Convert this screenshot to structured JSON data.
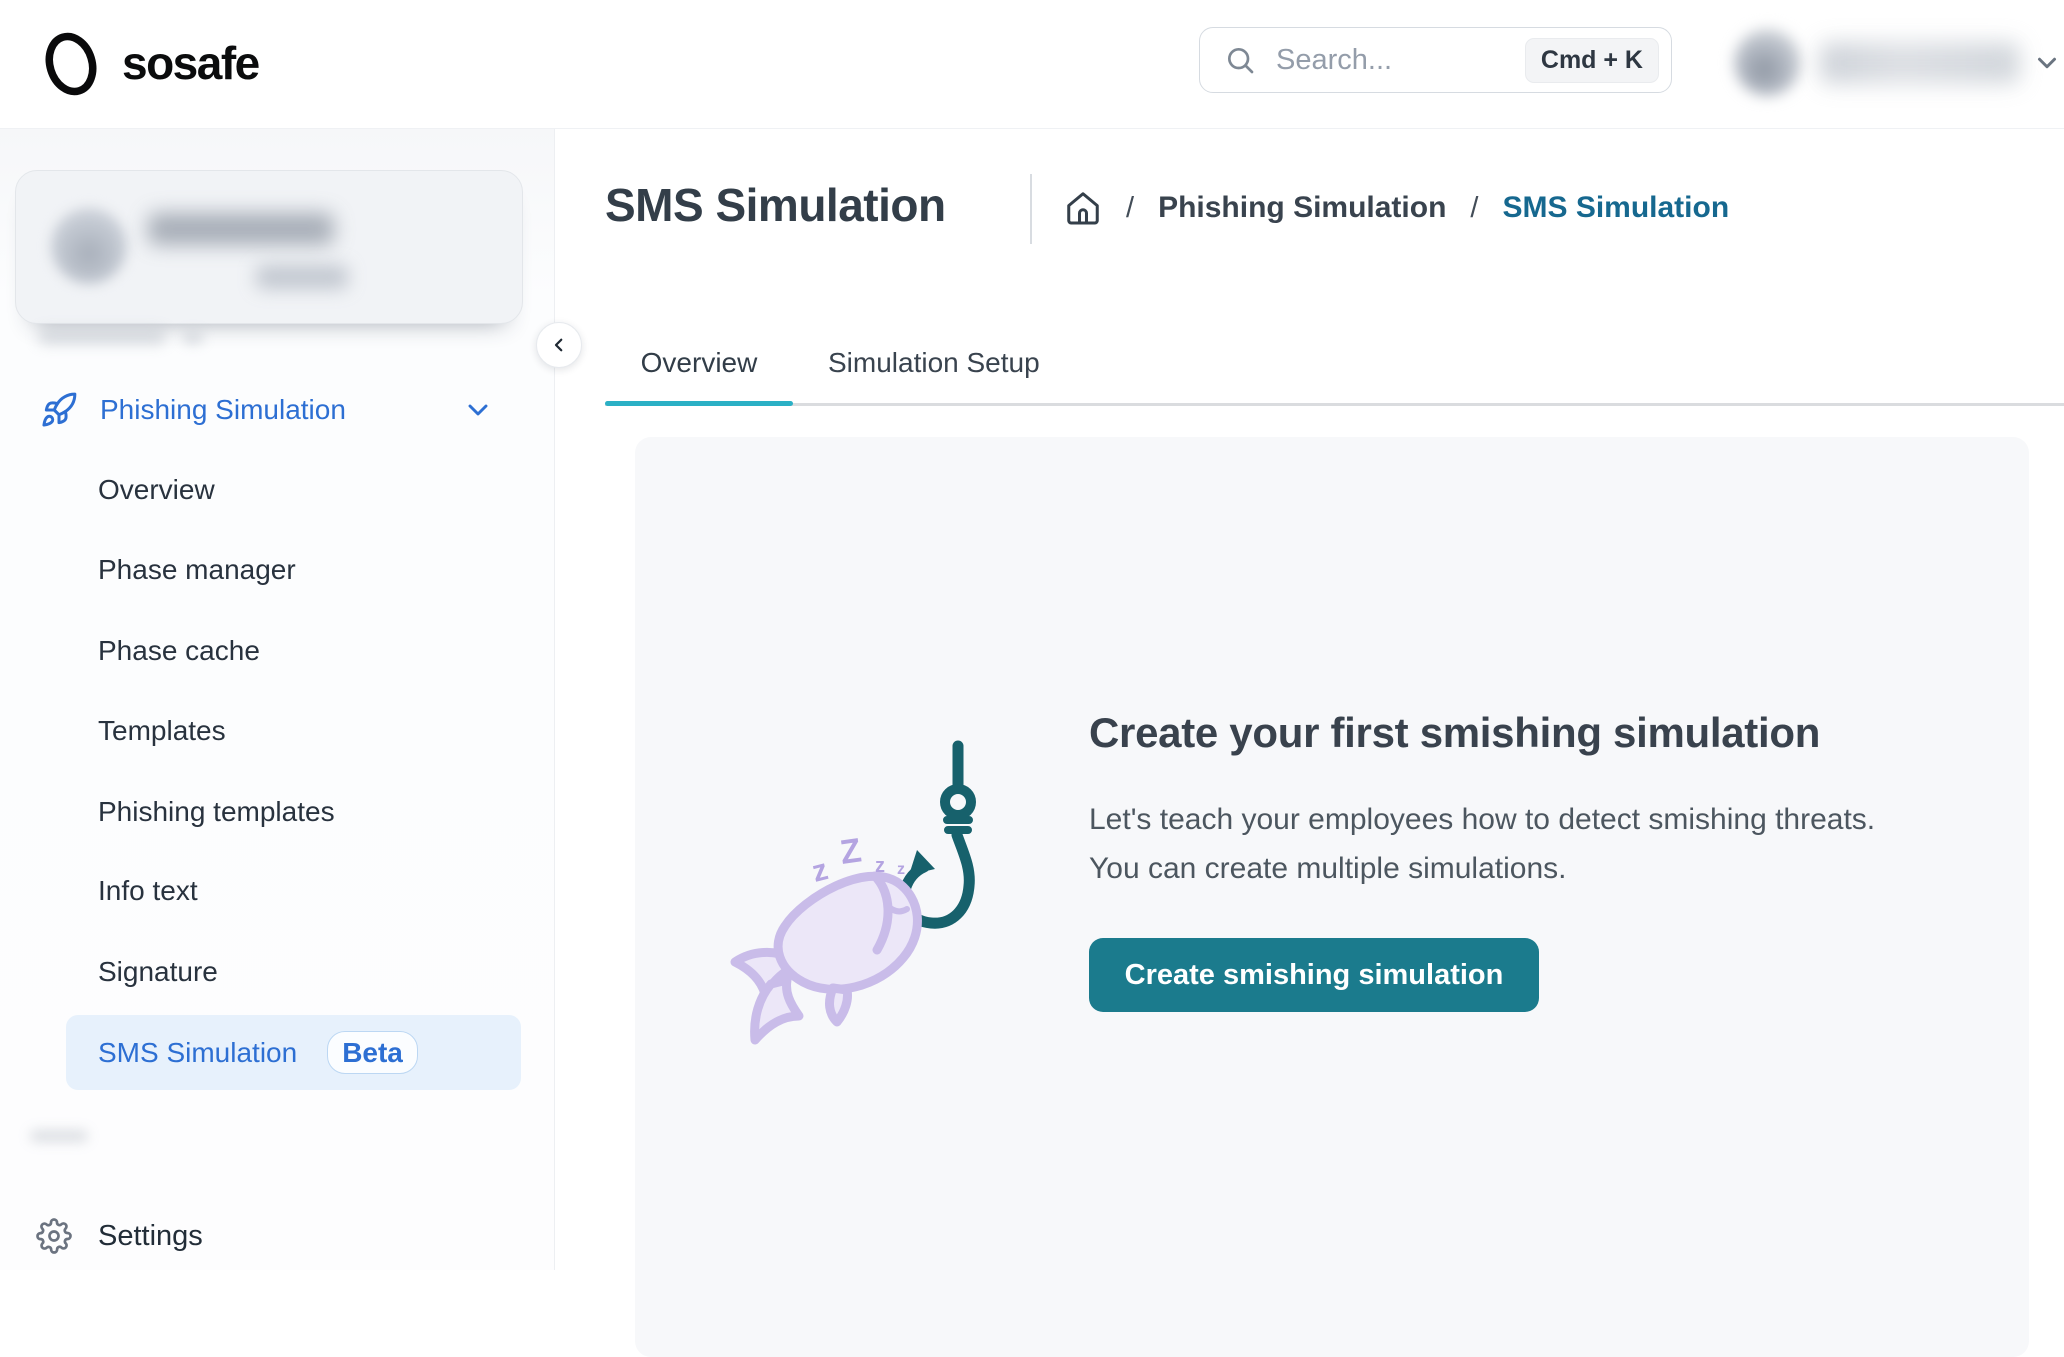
{
  "brand": {
    "logo_text": "sosafe"
  },
  "header": {
    "search": {
      "placeholder": "Search...",
      "shortcut_label": "Cmd + K"
    }
  },
  "sidebar": {
    "section": {
      "label": "Phishing Simulation"
    },
    "items": [
      {
        "label": "Overview"
      },
      {
        "label": "Phase manager"
      },
      {
        "label": "Phase cache"
      },
      {
        "label": "Templates"
      },
      {
        "label": "Phishing templates"
      },
      {
        "label": "Info text"
      },
      {
        "label": "Signature"
      },
      {
        "label": "SMS Simulation",
        "badge": "Beta"
      }
    ],
    "settings_label": "Settings"
  },
  "page": {
    "title": "SMS Simulation",
    "breadcrumb": {
      "separator": "/",
      "parent": "Phishing Simulation",
      "current": "SMS Simulation"
    },
    "tabs": {
      "overview": "Overview",
      "setup": "Simulation Setup"
    },
    "empty_state": {
      "heading": "Create your first smishing simulation",
      "line1": "Let's teach your employees how to detect smishing threats.",
      "line2": "You can create multiple simulations.",
      "cta": "Create smishing simulation",
      "sleep_letters": [
        "z",
        "Z",
        "z",
        "z"
      ]
    }
  },
  "colors": {
    "link_blue": "#2d6fd3",
    "breadcrumb_active": "#16688f",
    "tab_active_underline": "#2bb0c5",
    "cta_teal": "#1b7b8d",
    "hook_teal": "#17616c",
    "fish_lavender": "#c9bce9",
    "active_item_bg": "#e7f1fc"
  }
}
